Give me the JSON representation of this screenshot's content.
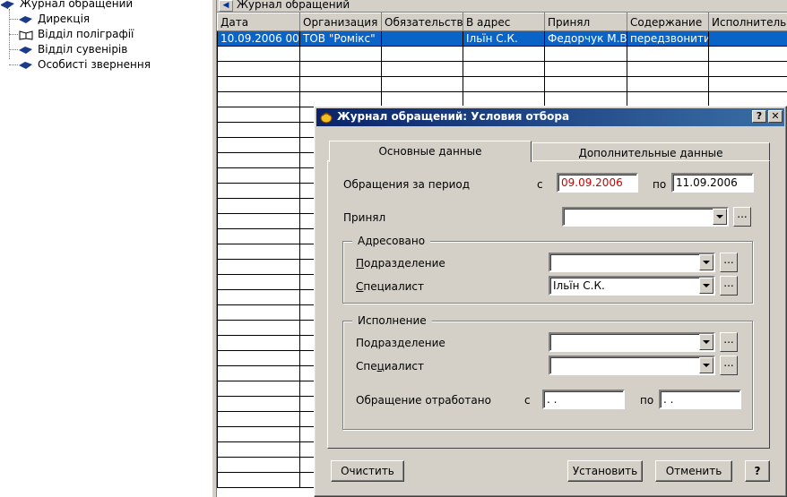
{
  "tree": {
    "root": "Журнал обращений",
    "items": [
      {
        "label": "Дирекція"
      },
      {
        "label": "Відділ поліграфії"
      },
      {
        "label": "Відділ сувенірів"
      },
      {
        "label": "Особисті звернення"
      }
    ]
  },
  "journal": {
    "title": "Журнал обращений",
    "columns": [
      "Дата",
      "Организация",
      "Обязательство",
      "В адрес",
      "Принял",
      "Содержание",
      "Исполнитель"
    ],
    "rows": [
      [
        "10.09.2006 00:",
        "ТОВ \"Ромікс\"",
        "",
        "Ільїн С.К.",
        "Федорчук М.В",
        "передзвонити",
        ""
      ]
    ]
  },
  "dialog": {
    "title": "Журнал обращений: Условия отбора",
    "help_btn": "?",
    "close_btn": "✕",
    "tabs": [
      {
        "label": "Основные данные",
        "active": true
      },
      {
        "label": "Дополнительные данные",
        "active": false
      }
    ],
    "period": {
      "label": "Обращения за период",
      "from_label": "с",
      "from_value": "09.09.2006",
      "to_label": "по",
      "to_value": "11.09.2006"
    },
    "prinyal": {
      "label": "Принял",
      "value": ""
    },
    "addressed": {
      "title": "Адресовано",
      "division": {
        "label_prefix": "",
        "label_underline": "П",
        "label_rest": "одразделение",
        "value": ""
      },
      "specialist": {
        "label_underline": "С",
        "label_rest": "пециалист",
        "value": "Ільїн С.К."
      }
    },
    "execution": {
      "title": "Исполнение",
      "division": {
        "label_pre": "По",
        "label_underline": "д",
        "label_rest": "разделение",
        "value": ""
      },
      "specialist": {
        "label_pre": "Спе",
        "label_underline": "ц",
        "label_rest": "иалист",
        "value": ""
      },
      "worked": {
        "label": "Обращение отработано",
        "from_label": "с",
        "from_value": " .  .",
        "to_label": "по",
        "to_value": " .  ."
      }
    },
    "ellipsis": "...",
    "buttons": {
      "clear": "Очистить",
      "apply": "Установить",
      "cancel": "Отменить",
      "help": "?"
    }
  },
  "colors": {
    "selection": "#0a64c8",
    "title_gradient_start": "#0a246a",
    "date_highlight_text": "#cc0000"
  }
}
